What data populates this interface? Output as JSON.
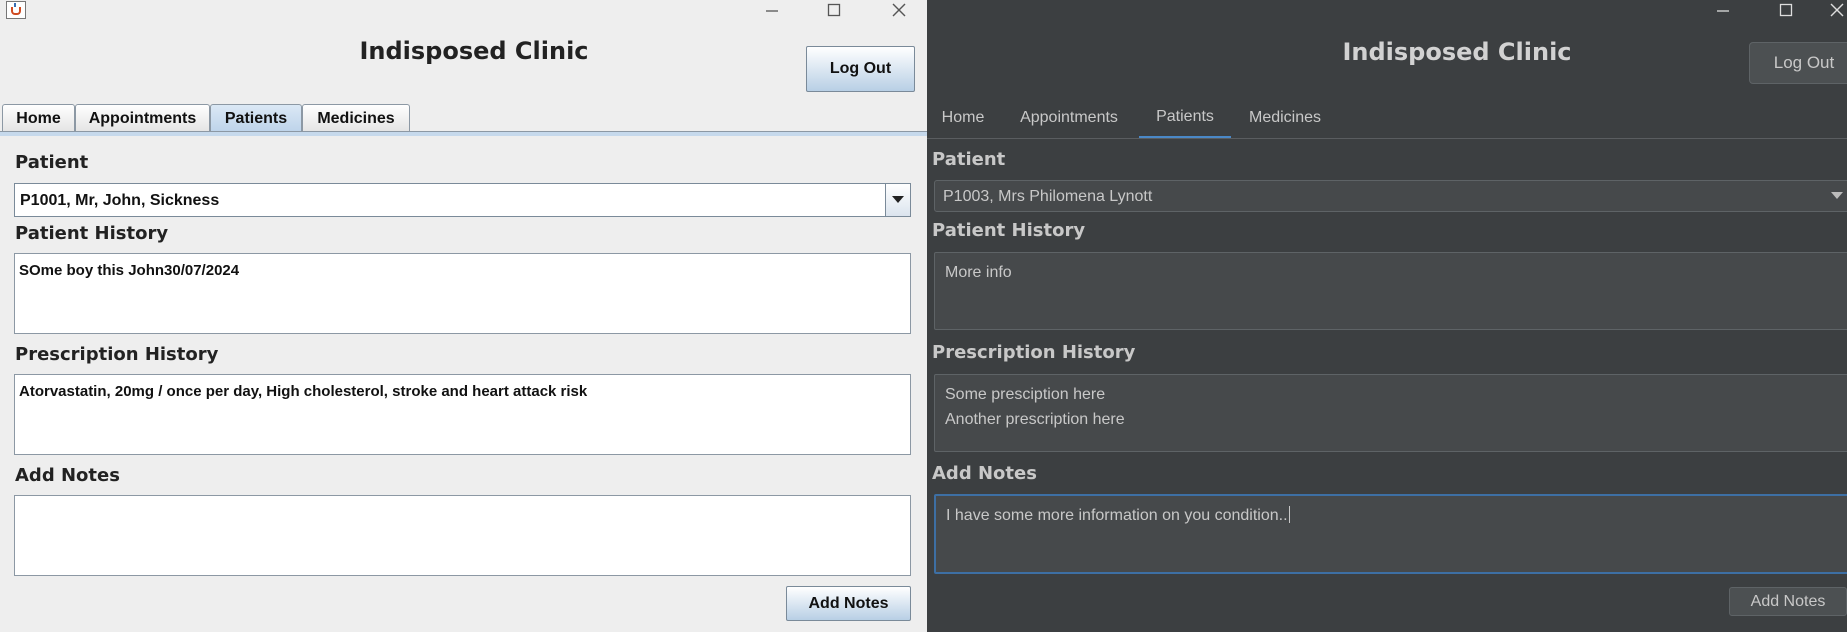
{
  "light_window": {
    "app_title": "Indisposed Clinic",
    "logout_label": "Log Out",
    "tabs": [
      "Home",
      "Appointments",
      "Patients",
      "Medicines"
    ],
    "selected_tab": "Patients",
    "patient_label": "Patient",
    "patient_selected": "P1001, Mr, John, Sickness",
    "patient_history_label": "Patient History",
    "patient_history_lines": [
      "SOme boy this John30/07/2024"
    ],
    "prescription_history_label": "Prescription History",
    "prescription_history_lines": [
      "Atorvastatin, 20mg / once per day, High cholesterol, stroke and heart attack risk"
    ],
    "add_notes_label": "Add Notes",
    "add_notes_value": "",
    "add_notes_button": "Add Notes"
  },
  "dark_window": {
    "app_title": "Indisposed Clinic",
    "logout_label": "Log Out",
    "tabs": [
      "Home",
      "Appointments",
      "Patients",
      "Medicines"
    ],
    "selected_tab": "Patients",
    "patient_label": "Patient",
    "patient_selected": "P1003, Mrs Philomena Lynott",
    "patient_history_label": "Patient History",
    "patient_history_lines": [
      "More info"
    ],
    "prescription_history_label": "Prescription History",
    "prescription_history_lines": [
      "Some presciption here",
      "Another prescription here"
    ],
    "add_notes_label": "Add Notes",
    "add_notes_value": "I have some more information on you condition..",
    "add_notes_button": "Add Notes"
  },
  "colors": {
    "light_bg": "#eeeeee",
    "light_accent": "#b8cfe5",
    "dark_bg": "#3c3f41",
    "dark_accent": "#4a88c7"
  },
  "icons": [
    "java-app-icon",
    "minimize-icon",
    "maximize-icon",
    "close-icon",
    "chevron-down-icon"
  ]
}
